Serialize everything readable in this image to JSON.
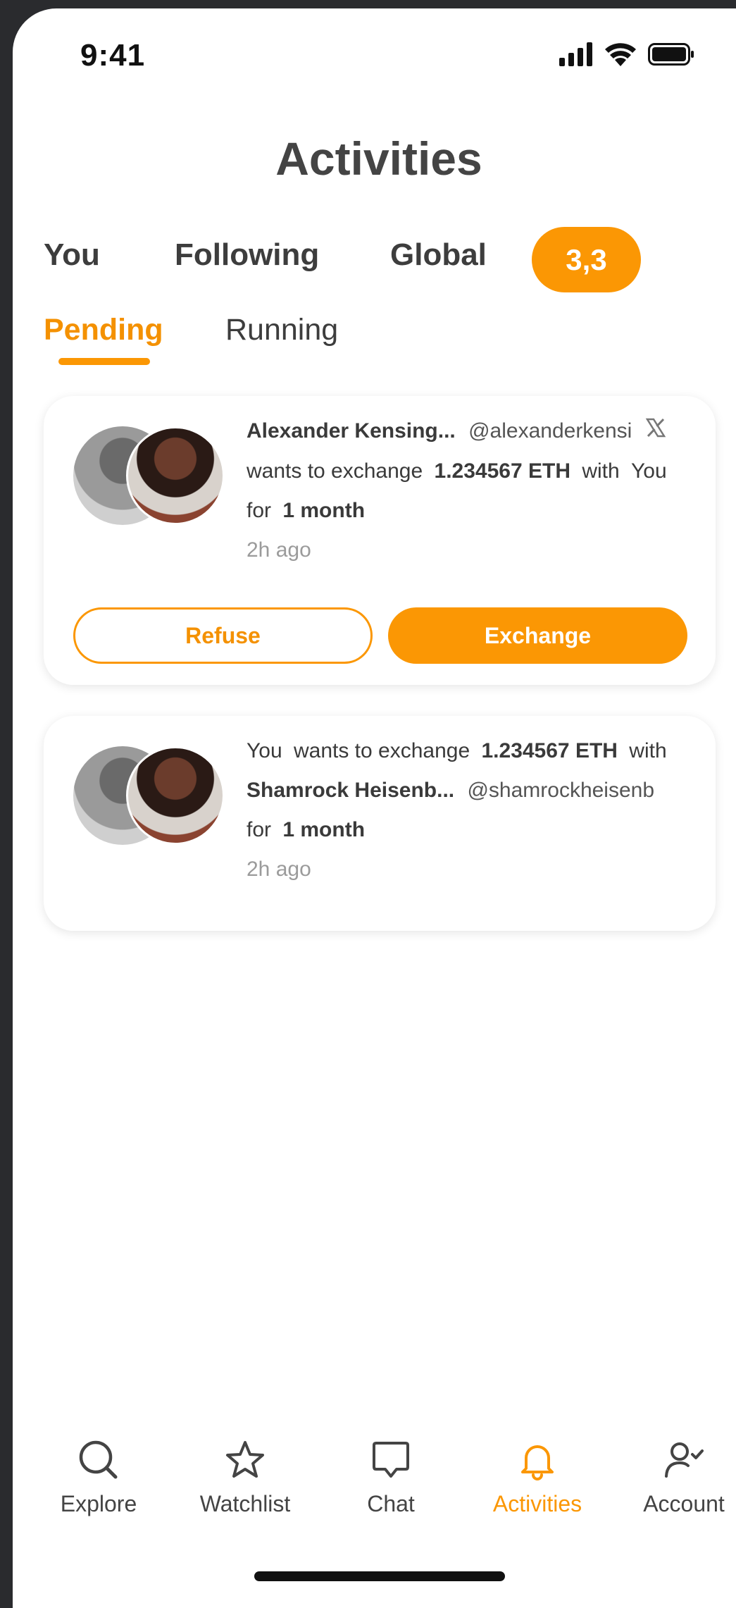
{
  "status_bar": {
    "time": "9:41"
  },
  "header": {
    "title": "Activities"
  },
  "main_tabs": {
    "you": "You",
    "following": "Following",
    "global": "Global",
    "pill": "3,3"
  },
  "sub_tabs": {
    "active": "Pending",
    "inactive": "Running"
  },
  "cards": [
    {
      "name": "Alexander Kensing...",
      "handle": "@alexanderkensi",
      "line2_a": "wants to exchange",
      "amount": "1.234567 ETH",
      "line2_b": "with",
      "counterparty": "You",
      "for_label": "for",
      "duration": "1 month",
      "time_ago": "2h ago",
      "refuse_label": "Refuse",
      "exchange_label": "Exchange"
    },
    {
      "actor": "You",
      "line1_a": "wants to exchange",
      "amount": "1.234567 ETH",
      "line1_b": "with",
      "name": "Shamrock Heisenb...",
      "handle": "@shamrockheisenb",
      "for_label": "for",
      "duration": "1 month",
      "time_ago": "2h ago"
    }
  ],
  "nav": {
    "explore": "Explore",
    "watchlist": "Watchlist",
    "chat": "Chat",
    "activities": "Activities",
    "account": "Account"
  },
  "colors": {
    "accent": "#fb9704",
    "text": "#3a3a3a",
    "muted": "#9b9b9b"
  },
  "icons": [
    "signal-icon",
    "wifi-icon",
    "battery-icon",
    "x-logo-icon",
    "search-icon",
    "star-icon",
    "chat-bubble-icon",
    "bell-icon",
    "account-check-icon"
  ]
}
